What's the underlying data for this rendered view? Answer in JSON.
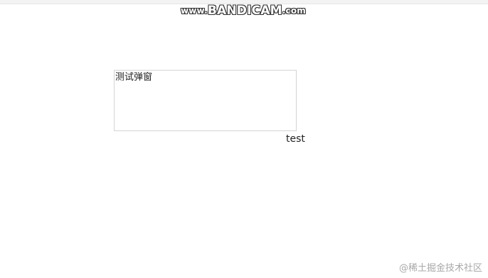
{
  "watermark": {
    "prefix": "www.",
    "brand": "BANDICAM",
    "suffix": ".com"
  },
  "popup": {
    "text": "测试弹窗"
  },
  "test_label": "test",
  "corner_watermark": "@稀土掘金技术社区"
}
